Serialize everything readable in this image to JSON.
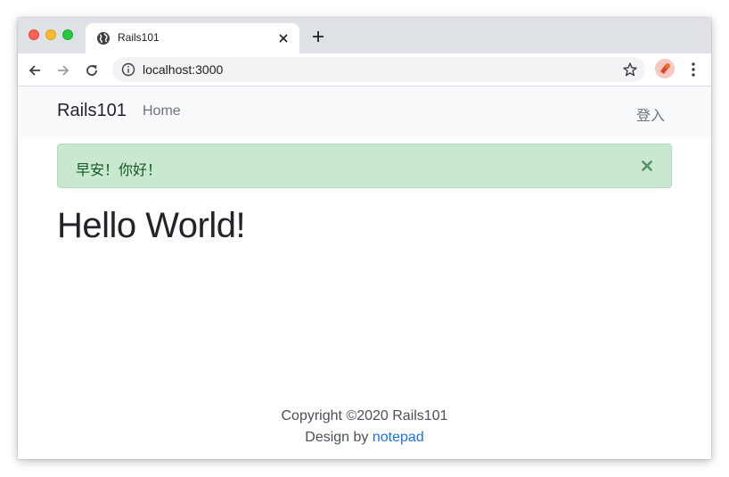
{
  "browser": {
    "tab": {
      "title": "Rails101"
    },
    "address_bar": {
      "url": "localhost:3000"
    }
  },
  "navbar": {
    "brand": "Rails101",
    "home_link": "Home",
    "login_link": "登入"
  },
  "alert": {
    "message": "早安！你好！",
    "color": "#c8e8d0"
  },
  "main": {
    "heading": "Hello World!"
  },
  "footer": {
    "copyright": "Copyright ©2020 Rails101",
    "design_prefix": "Design by",
    "design_link": "notepad"
  },
  "colors": {
    "link": "#1a73e8",
    "navbar_bg": "#f8f9fa"
  }
}
